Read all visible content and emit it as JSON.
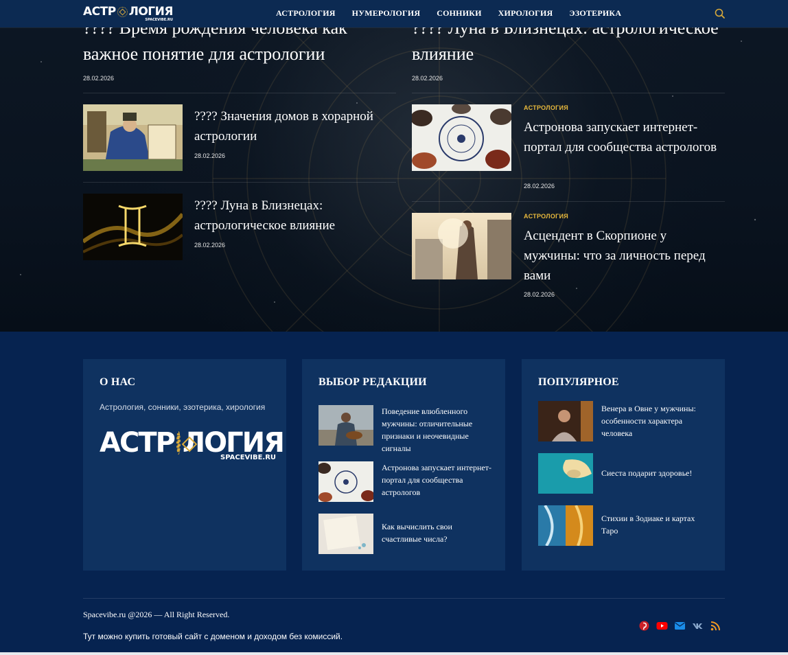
{
  "header": {
    "logo_text_left": "АСТР",
    "logo_text_right": "ЛОГИЯ",
    "logo_sub": "SPACEVIBE.RU",
    "nav": [
      "АСТРОЛОГИЯ",
      "НУМЕРОЛОГИЯ",
      "СОННИКИ",
      "ХИРОЛОГИЯ",
      "ЭЗОТЕРИКА"
    ],
    "search_icon": "search-icon",
    "accent": "#d8a93a"
  },
  "hero": {
    "top_posts": [
      {
        "title": "???? Время рождения человека как важное понятие для астрологии",
        "date": "28.02.2026"
      },
      {
        "title": "???? Луна в Близнецах: астрологическое влияние",
        "date": "28.02.2026"
      }
    ],
    "left_posts": [
      {
        "title": "???? Значения домов в хорарной астрологии",
        "date": "28.02.2026"
      },
      {
        "title": "???? Луна в Близнецах: астрологическое влияние",
        "date": "28.02.2026"
      }
    ],
    "right_posts": [
      {
        "category": "АСТРОЛОГИЯ",
        "title": "Астронова запускает интернет-портал для сообщества астрологов",
        "date": "28.02.2026"
      },
      {
        "category": "АСТРОЛОГИЯ",
        "title": "Асцендент в Скорпионе у мужчины: что за личность перед вами",
        "date": "28.02.2026"
      }
    ],
    "category_color": "#e8b93c"
  },
  "footer": {
    "about": {
      "title": "О НАС",
      "text": "Астрология, сонники, эзотерика, хирология",
      "logo_left": "АСТР",
      "logo_right": "ЛОГИЯ",
      "logo_sub": "SPACEVIBE.RU"
    },
    "editors": {
      "title": "ВЫБОР РЕДАКЦИИ",
      "items": [
        "Поведение влюбленного мужчины: отличительные признаки и неочевидные сигналы",
        "Астронова запускает интернет-портал для сообщества астрологов",
        "Как вычислить свои счастливые числа?"
      ]
    },
    "popular": {
      "title": "ПОПУЛЯРНОЕ",
      "items": [
        "Венера в Овне у мужчины: особенности характера человека",
        "Сиеста подарит здоровье!",
        "Стихии в Зодиаке и картах Таро"
      ]
    },
    "copyright": "Spacevibe.ru @2026 — All Right Reserved.",
    "sale_text": "Тут можно купить готовый сайт с доменом и доходом без комиссий.",
    "socials": [
      "pinterest-icon",
      "youtube-icon",
      "email-icon",
      "vk-icon",
      "rss-icon"
    ],
    "social_colors": [
      "#cb2027",
      "#ff0000",
      "#1a8ce8",
      "#8aa8cc",
      "#f39a21"
    ]
  }
}
